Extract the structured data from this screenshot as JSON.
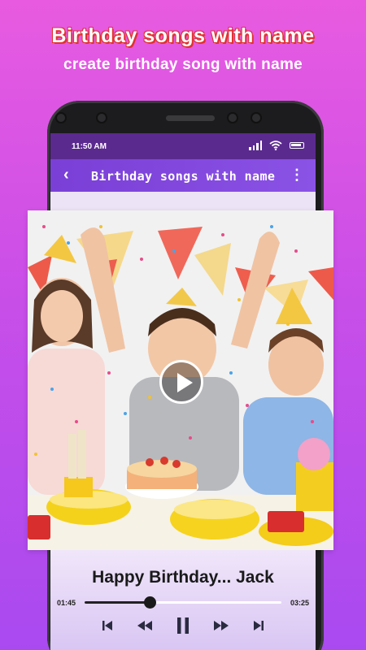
{
  "promo": {
    "headline": "Birthday songs with name",
    "subheadline": "create birthday song with name"
  },
  "statusbar": {
    "time": "11:50 AM"
  },
  "toolbar": {
    "title": "Birthday songs with name",
    "back_icon": "back-arrow-icon",
    "menu_icon": "more-vert-icon"
  },
  "player": {
    "song_title": "Happy Birthday... Jack",
    "current_time": "01:45",
    "total_time": "03:25",
    "progress": 0.33,
    "controls": [
      "skip-previous-icon",
      "rewind-icon",
      "pause-icon",
      "fast-forward-icon",
      "skip-next-icon"
    ]
  },
  "colors": {
    "background_top": "#e85be0",
    "background_bottom": "#a94af0",
    "toolbar": "#7a3fd6",
    "statusbar": "#5b2a8f",
    "headline_outline": "#e0322f"
  }
}
